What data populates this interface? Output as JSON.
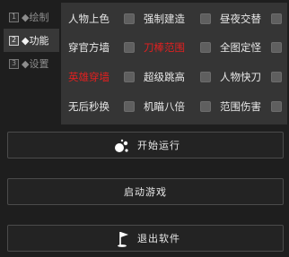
{
  "tabs": [
    {
      "num": "1",
      "label": "◆绘制"
    },
    {
      "num": "2",
      "label": "◆功能"
    },
    {
      "num": "3",
      "label": "◆设置"
    }
  ],
  "features": [
    {
      "label": "人物上色",
      "color": "#e8e8e8"
    },
    {
      "label": "强制建造",
      "color": "#e8e8e8"
    },
    {
      "label": "昼夜交替",
      "color": "#e8e8e8"
    },
    {
      "label": "穿官方墙",
      "color": "#e8e8e8"
    },
    {
      "label": "刀棒范围",
      "color": "#e02020"
    },
    {
      "label": "全图定怪",
      "color": "#e8e8e8"
    },
    {
      "label": "英雄穿墙",
      "color": "#e02020"
    },
    {
      "label": "超级跳高",
      "color": "#e8e8e8"
    },
    {
      "label": "人物快刀",
      "color": "#e8e8e8"
    },
    {
      "label": "无后秒换",
      "color": "#e8e8e8"
    },
    {
      "label": "机瞄八倍",
      "color": "#e8e8e8"
    },
    {
      "label": "范围伤害",
      "color": "#e8e8e8"
    }
  ],
  "buttons": {
    "start": "开始运行",
    "launch": "启动游戏",
    "exit": "退出软件"
  },
  "icons": {
    "start": "bubbles-icon",
    "exit": "flag-icon"
  }
}
